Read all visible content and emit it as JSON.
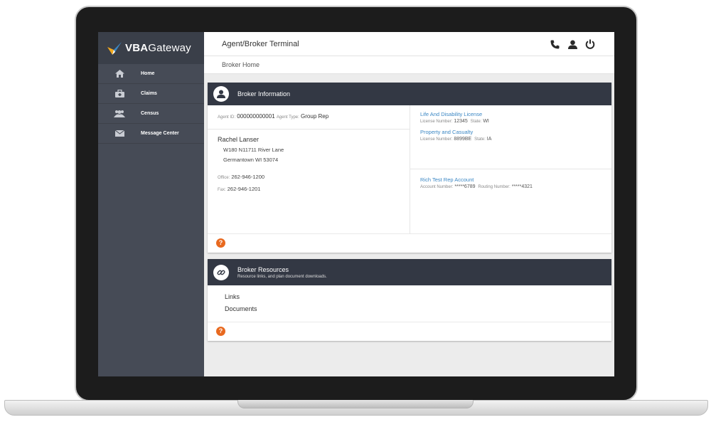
{
  "brand": {
    "name_bold": "VBA",
    "name_rest": "Gateway"
  },
  "colors": {
    "accent_blue": "#3b87c4",
    "help_orange": "#e8691f",
    "sidebar_bg": "#464b56",
    "card_header_bg": "#333844"
  },
  "sidebar": {
    "items": [
      {
        "label": "Home",
        "icon": "home-icon"
      },
      {
        "label": "Claims",
        "icon": "briefcase-icon"
      },
      {
        "label": "Census",
        "icon": "users-icon"
      },
      {
        "label": "Message Center",
        "icon": "envelope-icon"
      }
    ]
  },
  "header": {
    "title": "Agent/Broker Terminal",
    "icons": [
      "phone-icon",
      "user-icon",
      "power-icon"
    ]
  },
  "breadcrumb": {
    "current": "Broker Home"
  },
  "broker_info": {
    "title": "Broker Information",
    "agent_id_label": "Agent ID:",
    "agent_id": "000000000001",
    "agent_type_label": "Agent Type:",
    "agent_type": "Group Rep",
    "name": "Rachel Lanser",
    "address_line1": "W180 N11711 River Lane",
    "address_line2": "Germantown WI 53074",
    "office_label": "Office:",
    "office": "262-946-1200",
    "fax_label": "Fax:",
    "fax": "262-946-1201",
    "licenses": [
      {
        "title": "Life And Disability License",
        "number_label": "License Number:",
        "number": "12345",
        "state_label": "State:",
        "state": "WI"
      },
      {
        "title": "Property and Casualty",
        "number_label": "License Number:",
        "number": "8899BE",
        "state_label": "State:",
        "state": "IA"
      }
    ],
    "account": {
      "title": "Rich Test Rep Account",
      "account_label": "Account Number:",
      "account_number": "*****6789",
      "routing_label": "Routing Number:",
      "routing_number": "*****4321"
    },
    "help": "?"
  },
  "broker_resources": {
    "title": "Broker Resources",
    "subtitle": "Resource links, and plan document downloads.",
    "links": [
      "Links",
      "Documents"
    ],
    "help": "?"
  }
}
